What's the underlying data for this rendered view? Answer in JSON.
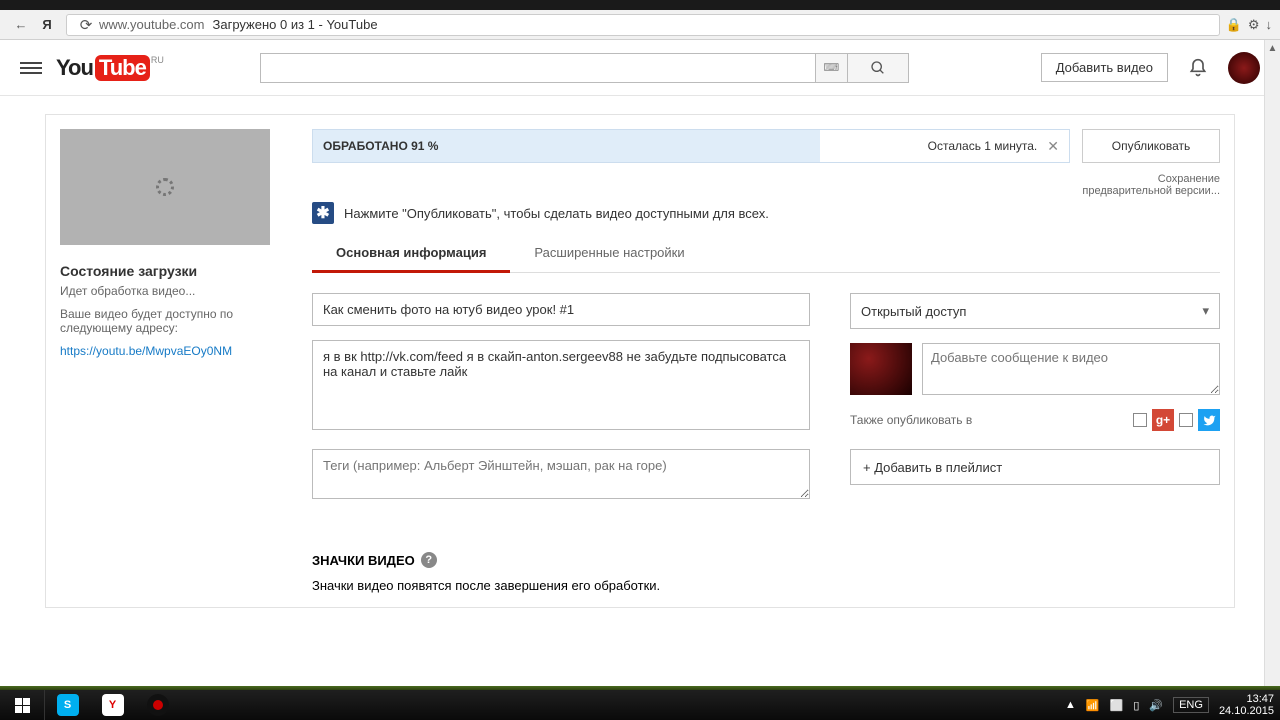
{
  "browser": {
    "url": "www.youtube.com",
    "title": "Загружено 0 из 1 - YouTube"
  },
  "masthead": {
    "logo_locale": "RU",
    "upload_label": "Добавить видео"
  },
  "left": {
    "status_title": "Состояние загрузки",
    "status_text": "Идет обработка видео...",
    "url_note": "Ваше видео будет доступно по следующему адресу:",
    "url": "https://youtu.be/MwpvaEOy0NM"
  },
  "progress": {
    "status": "ОБРАБОТАНО 91 %",
    "time_left": "Осталась 1 минута.",
    "publish": "Опубликовать",
    "save_note": "Сохранение предварительной версии..."
  },
  "hint": "Нажмите \"Опубликовать\", чтобы сделать видео доступными для всех.",
  "tabs": {
    "basic": "Основная информация",
    "advanced": "Расширенные настройки"
  },
  "form": {
    "title_value": "Как сменить фото на ютуб видео урок! #1",
    "desc_value": "я в вк http://vk.com/feed я в скайп-anton.sergeev88 не забудьте подпысоватса на канал и ставьте лайк",
    "tags_placeholder": "Теги (например: Альберт Эйнштейн, мэшап, рак на горе)",
    "privacy": "Открытый доступ",
    "share_placeholder": "Добавьте сообщение к видео",
    "also_publish": "Также опубликовать в",
    "playlist": "+ Добавить в плейлист"
  },
  "thumbs": {
    "title": "ЗНАЧКИ ВИДЕО",
    "text": "Значки видео появятся после завершения его обработки."
  },
  "taskbar": {
    "lang": "ENG",
    "time": "13:47",
    "date": "24.10.2015"
  }
}
